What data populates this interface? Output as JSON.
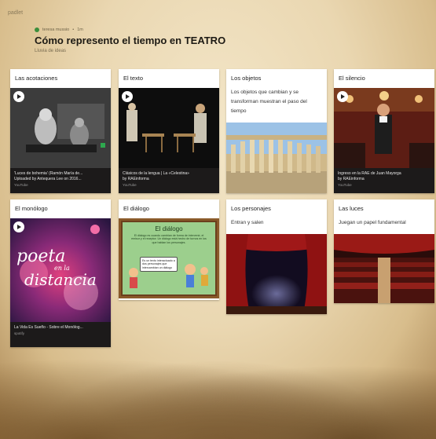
{
  "header": {
    "brand": "padlet",
    "author": "teresa mussio",
    "age": "1m",
    "title": "Cómo represento el tiempo en TEATRO",
    "subtitle": "Lluvia de ideas"
  },
  "cards": {
    "acotaciones": {
      "title": "Las acotaciones",
      "caption": "'Luces de bohemia' (Ramón María de...",
      "caption2": "Uploaded by Antequera Lee on 2016...",
      "source": "YouTube"
    },
    "texto": {
      "title": "El texto",
      "caption": "Clásicos de la lengua | La «Celestina»",
      "caption2": "by RAEinforma",
      "source": "YouTube"
    },
    "objetos": {
      "title": "Los objetos",
      "text": "Los objetos que cambian y se transforman muestran el paso del tiempo"
    },
    "silencio": {
      "title": "El silencio",
      "caption": "Ingreso en la RAE de Juan Mayorga",
      "caption2": "by RAEinforma",
      "source": "YouTube"
    },
    "monologo": {
      "title": "El monólogo",
      "poster_line1": "poeta",
      "poster_line2": "en la",
      "poster_line3": "distancia",
      "caption": "La Vida Es Sueño - Sobre el Monólog...",
      "source": "spotify"
    },
    "dialogo": {
      "title": "El diálogo",
      "slide_title": "El diálogo",
      "slide_text": "El diálogo es cuando cambian de forma de intervenir, el emisor y el receptor. Un diálogo está hecho de turnos en los que hablan los personajes.",
      "bubble": "Es un texto interactuado a dos personajes que intercambian un diálogo"
    },
    "personajes": {
      "title": "Los personajes",
      "text": "Entran y salen"
    },
    "luces": {
      "title": "Las luces",
      "text": "Juegan un papel fundamental"
    }
  },
  "colors": {
    "background": "#e9d9b8",
    "card": "#ffffff",
    "dark_card": "#1c1a1a",
    "author_dot": "#3b8e3b",
    "curtain_red": "#a01818"
  },
  "icons": [
    "play-icon",
    "spotify-icon"
  ]
}
